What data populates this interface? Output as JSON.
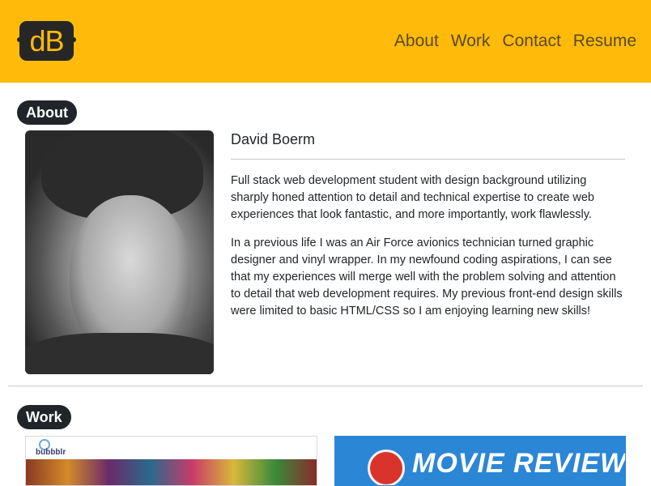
{
  "brand": {
    "logo_text": "dB"
  },
  "nav": {
    "items": [
      "About",
      "Work",
      "Contact",
      "Resume"
    ]
  },
  "about": {
    "section_label": "About",
    "name": "David Boerm",
    "paragraphs": [
      "Full stack web development student with design background utilizing sharply honed attention to detail and technical expertise to create web experiences that look fantastic, and more importantly, work flawlessly.",
      "In a previous life I was an Air Force avionics technician turned graphic designer and vinyl wrapper. In my newfound coding aspirations, I can see that my experiences will merge well with the problem solving and attention to detail that web development requires. My previous front-end design skills were limited to basic HTML/CSS so I am enjoying learning new skills!"
    ]
  },
  "work": {
    "section_label": "Work",
    "cards": [
      {
        "label": "bubbblr"
      },
      {
        "label": "MOVIE REVIEW"
      }
    ]
  },
  "colors": {
    "navbar": "#ffba0a",
    "badge": "#212529",
    "logo_bg": "#262626"
  }
}
